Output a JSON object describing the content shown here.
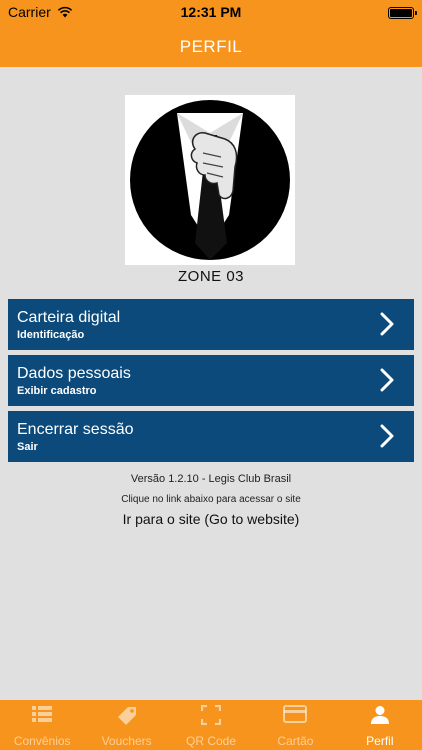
{
  "status_bar": {
    "carrier": "Carrier",
    "time": "12:31 PM"
  },
  "header": {
    "title": "PERFIL"
  },
  "profile": {
    "name": "ZONE 03"
  },
  "menu": [
    {
      "title": "Carteira digital",
      "subtitle": "Identificação"
    },
    {
      "title": "Dados pessoais",
      "subtitle": "Exibir cadastro"
    },
    {
      "title": "Encerrar sessão",
      "subtitle": "Sair"
    }
  ],
  "footer": {
    "version": "Versão 1.2.10 - Legis Club Brasil",
    "hint": "Clique no link abaixo para acessar o site",
    "link": "Ir para o site (Go to website)"
  },
  "tabs": [
    {
      "label": "Convênios",
      "icon": "list-icon"
    },
    {
      "label": "Vouchers",
      "icon": "tag-icon"
    },
    {
      "label": "QR Code",
      "icon": "qr-scan-icon"
    },
    {
      "label": "Cartão",
      "icon": "card-icon"
    },
    {
      "label": "Perfil",
      "icon": "person-icon",
      "active": true
    }
  ],
  "colors": {
    "accent": "#f7941d",
    "menu_bg": "#0b4a7a",
    "background": "#e0e0e0"
  }
}
